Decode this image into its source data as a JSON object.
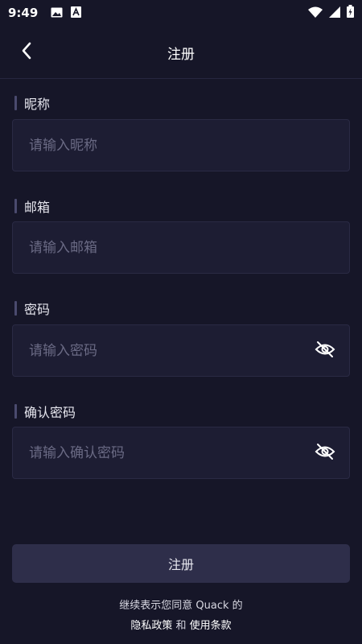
{
  "status_bar": {
    "time": "9:49",
    "left_icons": [
      "image-icon",
      "text-a-icon"
    ],
    "right_icons": [
      "wifi-icon",
      "signal-icon",
      "battery-icon"
    ]
  },
  "header": {
    "title": "注册",
    "back_icon": "chevron-left-icon"
  },
  "form": {
    "nickname": {
      "label": "昵称",
      "placeholder": "请输入昵称",
      "value": ""
    },
    "email": {
      "label": "邮箱",
      "placeholder": "请输入邮箱",
      "value": ""
    },
    "password": {
      "label": "密码",
      "placeholder": "请输入密码",
      "value": "",
      "toggle_icon": "eye-off-icon"
    },
    "confirm_password": {
      "label": "确认密码",
      "placeholder": "请输入确认密码",
      "value": "",
      "toggle_icon": "eye-off-icon"
    }
  },
  "submit_label": "注册",
  "agreement": {
    "prefix": "继续表示您同意 Quack 的",
    "privacy": "隐私政策",
    "and": "和",
    "terms": "使用条款"
  },
  "colors": {
    "background": "#161628",
    "input_bg": "#1d1d33",
    "button_bg": "#2e2e4a",
    "placeholder": "#6a6a84"
  }
}
